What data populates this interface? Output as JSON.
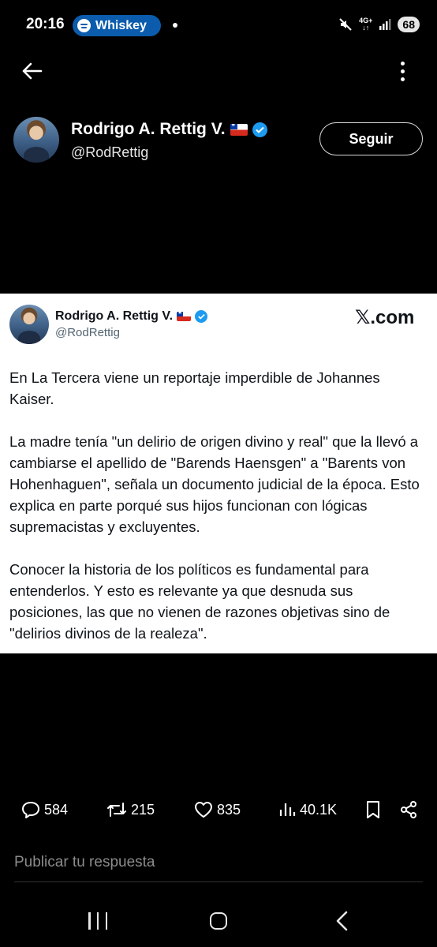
{
  "status_bar": {
    "time": "20:16",
    "spotify_label": "Whiskey",
    "network": "4G+",
    "battery": "68"
  },
  "header": {
    "name": "Rodrigo A. Rettig V.",
    "handle": "@RodRettig",
    "follow_label": "Seguir"
  },
  "card": {
    "name": "Rodrigo A. Rettig V.",
    "handle": "@RodRettig",
    "brand": "𝕏.com",
    "paragraphs": [
      "En La Tercera viene un reportaje imperdible de Johannes Kaiser.",
      "La madre tenía \"un delirio de origen divino y real\" que la llevó a cambiarse el apellido de \"Barends Haensgen\" a \"Barents von Hohenhaguen\", señala un documento judicial de la época. Esto explica en parte porqué sus hijos funcionan con lógicas supremacistas y excluyentes.",
      "Conocer la historia de los políticos es fundamental para entenderlos. Y esto es relevante ya que desnuda sus posiciones, las que no vienen de razones objetivas sino de \"delirios divinos de la realeza\"."
    ]
  },
  "actions": {
    "replies": "584",
    "reposts": "215",
    "likes": "835",
    "views": "40.1K"
  },
  "reply": {
    "placeholder": "Publicar tu respuesta"
  },
  "colors": {
    "accent": "#1d9bf0",
    "spotify_pill": "#0b5cad"
  }
}
